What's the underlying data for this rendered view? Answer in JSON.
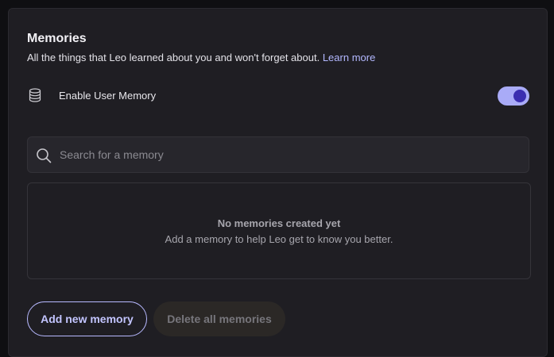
{
  "memories": {
    "title": "Memories",
    "description": "All the things that Leo learned about you and won't forget about.",
    "learn_more_label": "Learn more"
  },
  "user_memory": {
    "icon": "database-icon",
    "label": "Enable User Memory",
    "enabled": true
  },
  "search": {
    "icon": "search-icon",
    "placeholder": "Search for a memory",
    "value": ""
  },
  "empty_state": {
    "title": "No memories created yet",
    "message": "Add a memory to help Leo get to know you better."
  },
  "actions": {
    "add_label": "Add new memory",
    "delete_all_label": "Delete all memories"
  },
  "colors": {
    "accent": "#b3b8ff",
    "toggle_track": "#a9abf7",
    "toggle_knob": "#3a2db0",
    "panel_bg": "#1f1e23"
  }
}
